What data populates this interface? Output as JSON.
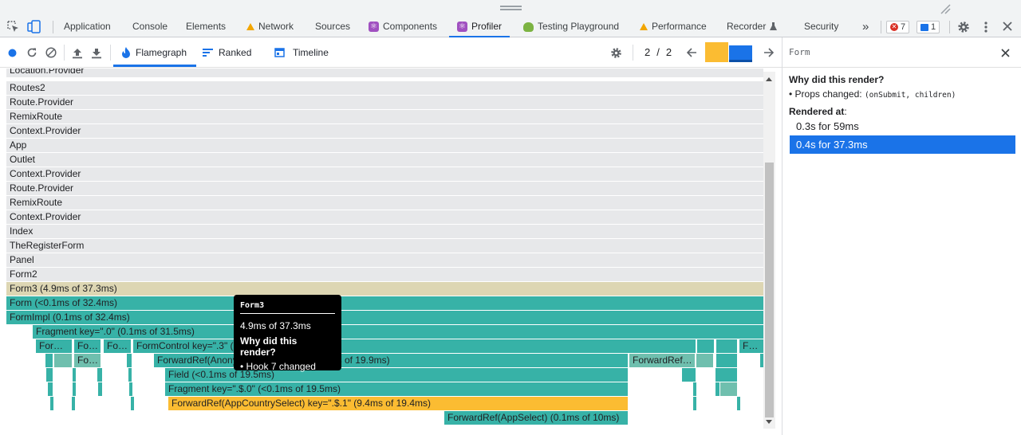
{
  "topbar": {
    "tabs": [
      {
        "label": "Application"
      },
      {
        "label": "Console"
      },
      {
        "label": "Elements"
      },
      {
        "label": "Network"
      },
      {
        "label": "Sources"
      },
      {
        "label": "Components"
      },
      {
        "label": "Profiler"
      },
      {
        "label": "Testing Playground"
      },
      {
        "label": "Performance"
      },
      {
        "label": "Recorder"
      },
      {
        "label": "Security"
      }
    ],
    "more": "»",
    "error_count": "7",
    "message_count": "1"
  },
  "toolbar": {
    "tabs": [
      {
        "label": "Flamegraph"
      },
      {
        "label": "Ranked"
      },
      {
        "label": "Timeline"
      }
    ],
    "commit_current": "2",
    "commit_sep": "/",
    "commit_total": "2"
  },
  "flame": {
    "rows": [
      {
        "label": "Location.Provider"
      },
      {
        "label": "Routes2"
      },
      {
        "label": "Route.Provider"
      },
      {
        "label": "RemixRoute"
      },
      {
        "label": "Context.Provider"
      },
      {
        "label": "App"
      },
      {
        "label": "Outlet"
      },
      {
        "label": "Context.Provider"
      },
      {
        "label": "Route.Provider"
      },
      {
        "label": "RemixRoute"
      },
      {
        "label": "Context.Provider"
      },
      {
        "label": "Index"
      },
      {
        "label": "TheRegisterForm"
      },
      {
        "label": "Panel"
      },
      {
        "label": "Form2"
      },
      {
        "label": "Form3 (4.9ms of 37.3ms)"
      },
      {
        "label": "Form (<0.1ms of 32.4ms)"
      },
      {
        "label": "FormImpl (0.1ms of 32.4ms)"
      },
      {
        "label": "Fragment key=\".0\" (0.1ms of 31.5ms)"
      }
    ],
    "small_bars": {
      "for1": "For…",
      "fo1": "Fo…",
      "fo2": "Fo…",
      "formcontrol": "FormControl key=\".3\" (0.1ms of 19.9ms)",
      "for_right": "For…",
      "fo3": "Fo…",
      "forwardref_anon": "ForwardRef(Anonymous) key=\".$.0\" (0.1ms of 19.9ms)",
      "forwardref_right": "ForwardRef…",
      "field": "Field (<0.1ms of 19.5ms)",
      "fragment_s0": "Fragment key=\".$.0\" (<0.1ms of 19.5ms)",
      "country_select": "ForwardRef(AppCountrySelect) key=\".$.1\" (9.4ms of 19.4ms)",
      "app_select": "ForwardRef(AppSelect) (0.1ms of 10ms)"
    }
  },
  "tooltip": {
    "title": "Form3",
    "duration": "4.9ms of 37.3ms",
    "why_heading": "Why did this render?",
    "reason": "• Hook 7 changed"
  },
  "sidebar": {
    "title": "Form",
    "why_heading": "Why did this render?",
    "props_changed_label": "• Props changed:",
    "props_changed_value": "(onSubmit, children)",
    "rendered_at_label": "Rendered at",
    "rendered_at_colon": ":",
    "commits": [
      {
        "label": "0.3s for 59ms"
      },
      {
        "label": "0.4s for 37.3ms"
      }
    ]
  },
  "colors": {
    "teal": "#37b2a7",
    "orange": "#fbbc32",
    "tan": "#ddd6b3",
    "accent": "#1a73e8"
  }
}
